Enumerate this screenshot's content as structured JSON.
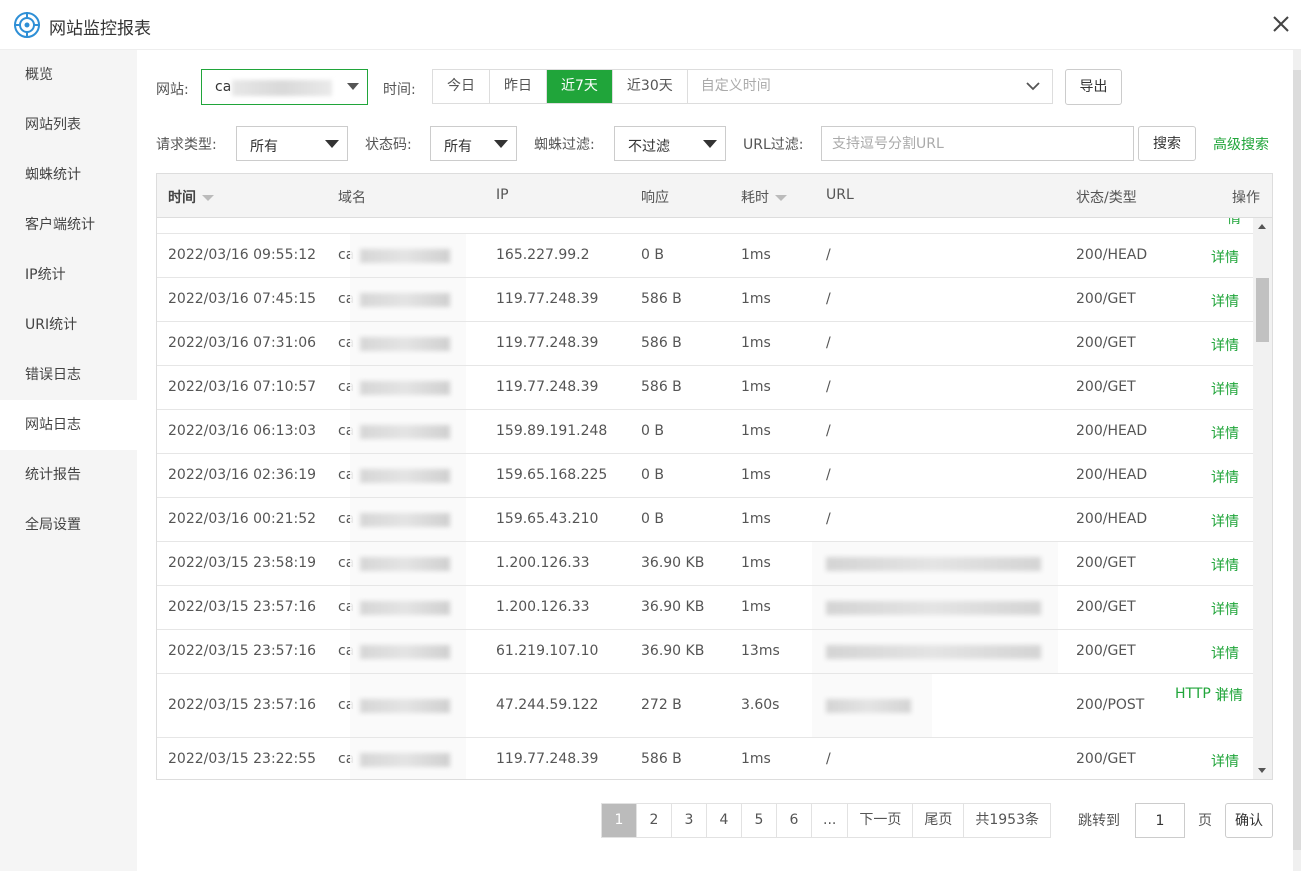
{
  "window": {
    "title": "网站监控报表",
    "accent_color": "#20a53a"
  },
  "sidebar": {
    "items": [
      {
        "label": "概览"
      },
      {
        "label": "网站列表"
      },
      {
        "label": "蜘蛛统计"
      },
      {
        "label": "客户端统计"
      },
      {
        "label": "IP统计"
      },
      {
        "label": "URI统计"
      },
      {
        "label": "错误日志"
      },
      {
        "label": "网站日志",
        "active": true
      },
      {
        "label": "统计报告"
      },
      {
        "label": "全局设置"
      }
    ]
  },
  "filters": {
    "site_label": "网站:",
    "site_value": "ca",
    "time_label": "时间:",
    "time_buttons": [
      "今日",
      "昨日",
      "近7天",
      "近30天"
    ],
    "time_active": "近7天",
    "custom_time_placeholder": "自定义时间",
    "export_label": "导出",
    "request_type_label": "请求类型:",
    "request_type_value": "所有",
    "status_code_label": "状态码:",
    "status_code_value": "所有",
    "spider_filter_label": "蜘蛛过滤:",
    "spider_filter_value": "不过滤",
    "url_filter_label": "URL过滤:",
    "url_filter_placeholder": "支持逗号分割URL",
    "search_label": "搜索",
    "advanced_search_label": "高级搜索"
  },
  "table": {
    "headers": {
      "time": "时间",
      "domain": "域名",
      "ip": "IP",
      "response": "响应",
      "duration": "耗时",
      "url": "URL",
      "status": "状态/类型",
      "action": "操作"
    },
    "partial_top_action": "情",
    "rows": [
      {
        "time": "2022/03/16 09:55:12",
        "domain": "ca",
        "ip": "165.227.99.2",
        "response": "0 B",
        "duration": "1ms",
        "url": "/",
        "status": "200/HEAD",
        "action": "详情"
      },
      {
        "time": "2022/03/16 07:45:15",
        "domain": "ca",
        "ip": "119.77.248.39",
        "response": "586 B",
        "duration": "1ms",
        "url": "/",
        "status": "200/GET",
        "action": "详情"
      },
      {
        "time": "2022/03/16 07:31:06",
        "domain": "ca",
        "ip": "119.77.248.39",
        "response": "586 B",
        "duration": "1ms",
        "url": "/",
        "status": "200/GET",
        "action": "详情"
      },
      {
        "time": "2022/03/16 07:10:57",
        "domain": "ca",
        "ip": "119.77.248.39",
        "response": "586 B",
        "duration": "1ms",
        "url": "/",
        "status": "200/GET",
        "action": "详情"
      },
      {
        "time": "2022/03/16 06:13:03",
        "domain": "ca",
        "ip": "159.89.191.248",
        "response": "0 B",
        "duration": "1ms",
        "url": "/",
        "status": "200/HEAD",
        "action": "详情"
      },
      {
        "time": "2022/03/16 02:36:19",
        "domain": "ca",
        "ip": "159.65.168.225",
        "response": "0 B",
        "duration": "1ms",
        "url": "/",
        "status": "200/HEAD",
        "action": "详情"
      },
      {
        "time": "2022/03/16 00:21:52",
        "domain": "ca",
        "ip": "159.65.43.210",
        "response": "0 B",
        "duration": "1ms",
        "url": "/",
        "status": "200/HEAD",
        "action": "详情"
      },
      {
        "time": "2022/03/15 23:58:19",
        "domain": "ca",
        "ip": "1.200.126.33",
        "response": "36.90 KB",
        "duration": "1ms",
        "url": "",
        "status": "200/GET",
        "action": "详情"
      },
      {
        "time": "2022/03/15 23:57:16",
        "domain": "ca",
        "ip": "1.200.126.33",
        "response": "36.90 KB",
        "duration": "1ms",
        "url": "",
        "status": "200/GET",
        "action": "详情"
      },
      {
        "time": "2022/03/15 23:57:16",
        "domain": "ca",
        "ip": "61.219.107.10",
        "response": "36.90 KB",
        "duration": "13ms",
        "url": "",
        "status": "200/GET",
        "action": "详情"
      },
      {
        "time": "2022/03/15 23:57:16",
        "domain": "ca",
        "ip": "47.244.59.122",
        "response": "272 B",
        "duration": "3.60s",
        "url": "",
        "status": "200/POST",
        "action_http": "HTTP",
        "action_sep": "|",
        "action": "详情"
      },
      {
        "time": "2022/03/15 23:22:55",
        "domain": "ca",
        "ip": "119.77.248.39",
        "response": "586 B",
        "duration": "1ms",
        "url": "/",
        "status": "200/GET",
        "action": "详情"
      }
    ]
  },
  "pagination": {
    "pages": [
      "1",
      "2",
      "3",
      "4",
      "5",
      "6",
      "..."
    ],
    "current": "1",
    "next_label": "下一页",
    "last_label": "尾页",
    "total_label": "共1953条",
    "jump_label": "跳转到",
    "jump_value": "1",
    "page_suffix": "页",
    "confirm_label": "确认"
  }
}
